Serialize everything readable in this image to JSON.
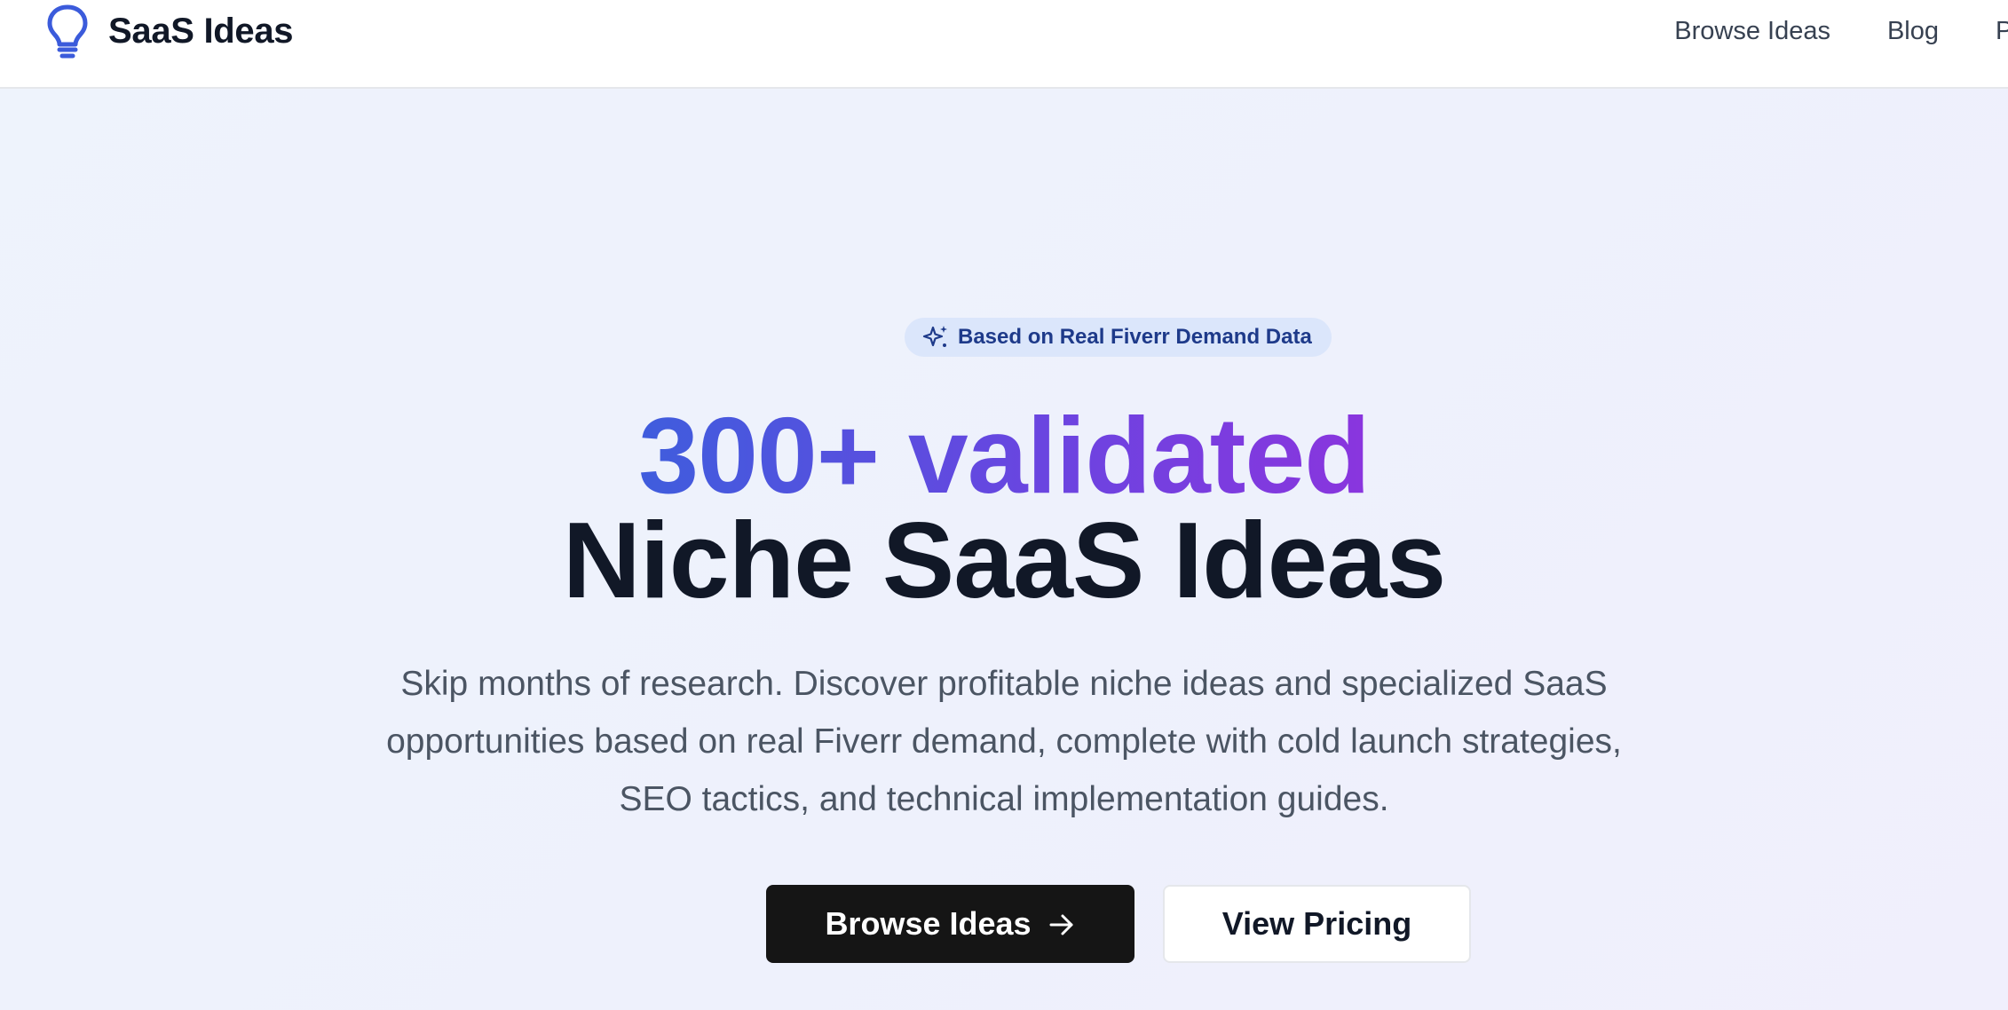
{
  "header": {
    "logo_text": "SaaS Ideas",
    "logo_icon": "lightbulb-icon",
    "nav": [
      {
        "label": "Browse Ideas"
      },
      {
        "label": "Blog"
      },
      {
        "label": "P"
      }
    ]
  },
  "hero": {
    "badge": {
      "icon": "sparkles-icon",
      "text": "Based on Real Fiverr Demand Data"
    },
    "headline_line1": "300+ validated",
    "headline_line2": "Niche SaaS Ideas",
    "subtitle": "Skip months of research. Discover profitable niche ideas and specialized SaaS opportunities based on real Fiverr demand, complete with cold launch strategies, SEO tactics, and technical implementation guides.",
    "primary_cta": {
      "label": "Browse Ideas",
      "icon": "arrow-right-icon"
    },
    "secondary_cta": {
      "label": "View Pricing"
    }
  },
  "colors": {
    "brand_blue": "#3f5ddd",
    "gradient_end": "#8a35de",
    "badge_bg": "#dbe6fb",
    "badge_text": "#1e3a8a",
    "dark": "#111827",
    "button_dark": "#151515"
  }
}
